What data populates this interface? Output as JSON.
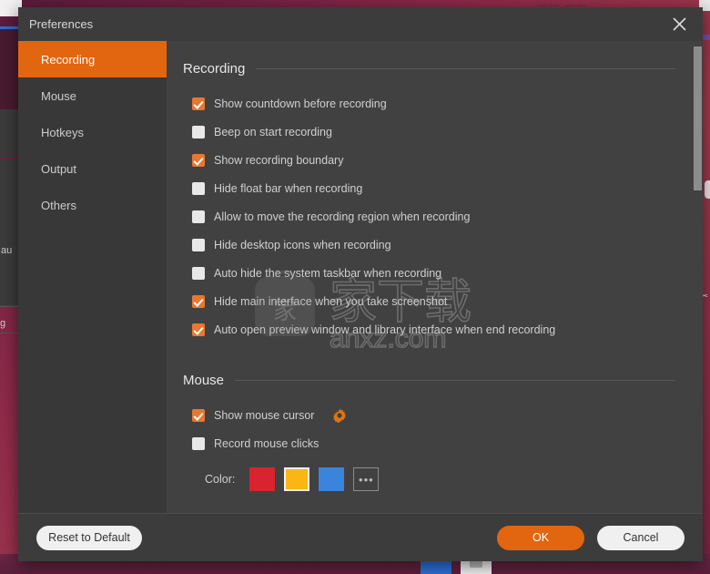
{
  "window": {
    "title": "Preferences",
    "close_icon": "close-icon"
  },
  "sidebar": {
    "items": [
      {
        "label": "Recording",
        "active": true
      },
      {
        "label": "Mouse",
        "active": false
      },
      {
        "label": "Hotkeys",
        "active": false
      },
      {
        "label": "Output",
        "active": false
      },
      {
        "label": "Others",
        "active": false
      }
    ]
  },
  "sections": {
    "recording": {
      "title": "Recording",
      "options": [
        {
          "label": "Show countdown before recording",
          "checked": true
        },
        {
          "label": "Beep on start recording",
          "checked": false
        },
        {
          "label": "Show recording boundary",
          "checked": true
        },
        {
          "label": "Hide float bar when recording",
          "checked": false
        },
        {
          "label": "Allow to move the recording region when recording",
          "checked": false
        },
        {
          "label": "Hide desktop icons when recording",
          "checked": false
        },
        {
          "label": "Auto hide the system taskbar when recording",
          "checked": false
        },
        {
          "label": "Hide main interface when you take screenshot",
          "checked": true
        },
        {
          "label": "Auto open preview window and library interface when end recording",
          "checked": true
        }
      ]
    },
    "mouse": {
      "title": "Mouse",
      "options": [
        {
          "label": "Show mouse cursor",
          "checked": true,
          "gear": "gear-icon"
        },
        {
          "label": "Record mouse clicks",
          "checked": false
        }
      ],
      "color_label": "Color:",
      "swatches": [
        {
          "name": "red",
          "hex": "#d9232e",
          "selected": false
        },
        {
          "name": "yellow",
          "hex": "#fbb515",
          "selected": true
        },
        {
          "name": "blue",
          "hex": "#3b84dc",
          "selected": false
        }
      ],
      "more_label": "•••"
    }
  },
  "footer": {
    "reset_label": "Reset to Default",
    "ok_label": "OK",
    "cancel_label": "Cancel"
  },
  "watermark": {
    "cn_text": "家下载",
    "site": "anxz.com"
  },
  "background": {
    "label_au": "au",
    "label_g": "g",
    "top_glyphs": "—— ——",
    "right_glyph": "✂"
  },
  "colors": {
    "accent": "#e2660f",
    "checkbox_on": "#e87730",
    "dialog_bg": "#3c3c3c",
    "content_bg": "#414141",
    "sidebar_bg": "#383838",
    "text": "#cfcfcf"
  }
}
